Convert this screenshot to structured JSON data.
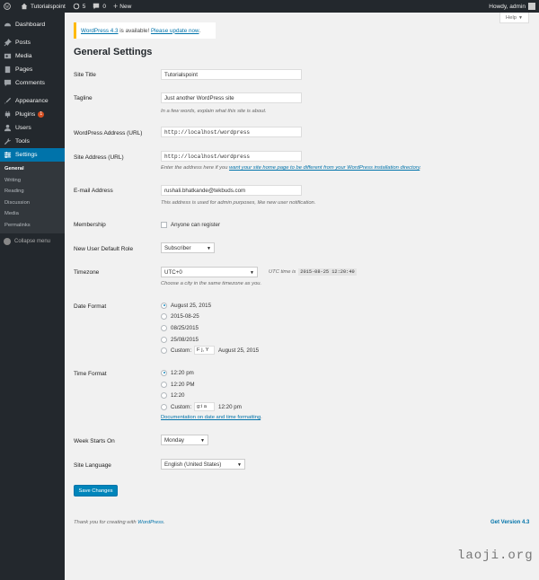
{
  "adminbar": {
    "site_name": "Tutorialspoint",
    "updates_count": "5",
    "comments_count": "0",
    "new_label": "New",
    "howdy": "Howdy, admin"
  },
  "sidebar": {
    "items": [
      {
        "label": "Dashboard",
        "icon": "dashboard-icon"
      },
      {
        "label": "Posts",
        "icon": "pin-icon"
      },
      {
        "label": "Media",
        "icon": "media-icon"
      },
      {
        "label": "Pages",
        "icon": "page-icon"
      },
      {
        "label": "Comments",
        "icon": "comment-icon"
      },
      {
        "label": "Appearance",
        "icon": "brush-icon"
      },
      {
        "label": "Plugins",
        "icon": "plug-icon",
        "badge": "1"
      },
      {
        "label": "Users",
        "icon": "user-icon"
      },
      {
        "label": "Tools",
        "icon": "wrench-icon"
      },
      {
        "label": "Settings",
        "icon": "settings-icon"
      }
    ],
    "submenu": [
      "General",
      "Writing",
      "Reading",
      "Discussion",
      "Media",
      "Permalinks"
    ],
    "collapse_label": "Collapse menu"
  },
  "help_label": "Help",
  "notice": {
    "version_link": "WordPress 4.3",
    "middle_text": " is available! ",
    "update_link": "Please update now",
    "end": "."
  },
  "page_title": "General Settings",
  "fields": {
    "site_title": {
      "label": "Site Title",
      "value": "Tutorialspoint"
    },
    "tagline": {
      "label": "Tagline",
      "value": "Just another WordPress site",
      "desc": "In a few words, explain what this site is about."
    },
    "wp_address": {
      "label": "WordPress Address (URL)",
      "value": "http://localhost/wordpress"
    },
    "site_address": {
      "label": "Site Address (URL)",
      "value": "http://localhost/wordpress",
      "desc_pre": "Enter the address here if you ",
      "desc_link": "want your site home page to be different from your WordPress installation directory",
      "desc_post": "."
    },
    "email": {
      "label": "E-mail Address",
      "value": "rushali.bhatkande@tekbuds.com",
      "desc": "This address is used for admin purposes, like new user notification."
    },
    "membership": {
      "label": "Membership",
      "checkbox_label": "Anyone can register"
    },
    "default_role": {
      "label": "New User Default Role",
      "value": "Subscriber"
    },
    "timezone": {
      "label": "Timezone",
      "value": "UTC+0",
      "utc_label": "UTC time is",
      "utc_value": "2015-08-25 12:20:40",
      "desc": "Choose a city in the same timezone as you."
    },
    "date_format": {
      "label": "Date Format",
      "options": [
        "August 25, 2015",
        "2015-08-25",
        "08/25/2015",
        "25/08/2015"
      ],
      "custom_label": "Custom:",
      "custom_value": "F j, Y",
      "custom_preview": "August 25, 2015"
    },
    "time_format": {
      "label": "Time Format",
      "options": [
        "12:20 pm",
        "12:20 PM",
        "12:20"
      ],
      "custom_label": "Custom:",
      "custom_value": "g:i a",
      "custom_preview": "12:20 pm",
      "doc_link": "Documentation on date and time formatting",
      "doc_end": "."
    },
    "week_starts": {
      "label": "Week Starts On",
      "value": "Monday"
    },
    "site_language": {
      "label": "Site Language",
      "value": "English (United States)"
    }
  },
  "save_label": "Save Changes",
  "footer": {
    "thanks_pre": "Thank you for creating with ",
    "thanks_link": "WordPress",
    "thanks_end": ".",
    "version": "Get Version 4.3"
  },
  "watermark": "laoji.org",
  "colors": {
    "accent": "#0073aa",
    "sidebar": "#23282d",
    "active": "#0073aa",
    "notice_border": "#ffba00",
    "button": "#0085ba"
  }
}
